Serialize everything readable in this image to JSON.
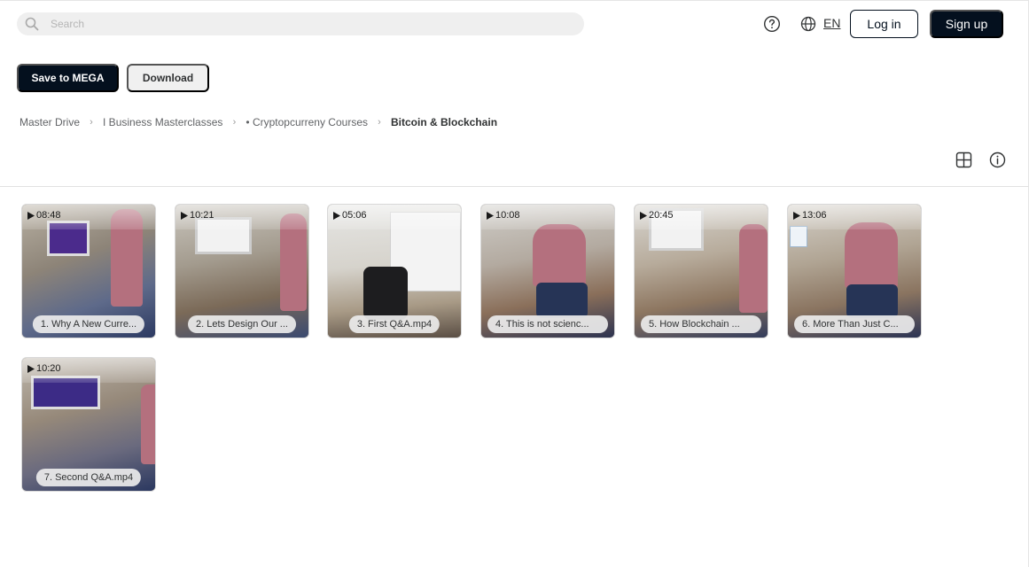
{
  "header": {
    "search_placeholder": "Search",
    "language": "EN",
    "login_label": "Log in",
    "signup_label": "Sign up"
  },
  "actions": {
    "save_label": "Save to MEGA",
    "download_label": "Download"
  },
  "breadcrumb": [
    "Master Drive",
    "I Business Masterclasses",
    "• Cryptopcurreny Courses",
    "Bitcoin & Blockchain"
  ],
  "files": [
    {
      "duration": "08:48",
      "name": "1. Why A New Curre..."
    },
    {
      "duration": "10:21",
      "name": "2. Lets Design Our ..."
    },
    {
      "duration": "05:06",
      "name": "3. First Q&A.mp4"
    },
    {
      "duration": "10:08",
      "name": "4. This is not scienc..."
    },
    {
      "duration": "20:45",
      "name": "5. How Blockchain ..."
    },
    {
      "duration": "13:06",
      "name": "6. More Than Just C..."
    },
    {
      "duration": "10:20",
      "name": "7. Second Q&A.mp4"
    }
  ],
  "colors": {
    "primary": "#04101e",
    "secondary_button": "#f0f0f0",
    "search_bg": "#efefef"
  },
  "icons": [
    "search-icon",
    "help-icon",
    "globe-icon",
    "chevron-right-icon",
    "grid-view-icon",
    "info-icon",
    "play-icon"
  ]
}
